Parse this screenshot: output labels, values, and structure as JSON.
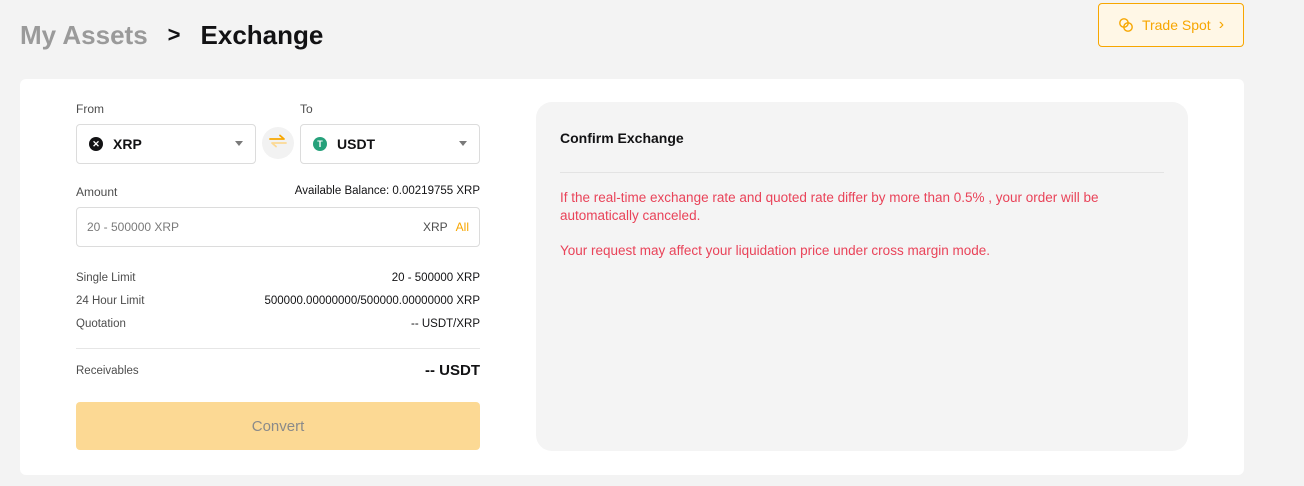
{
  "breadcrumb": {
    "parent": "My Assets",
    "separator": ">",
    "current": "Exchange"
  },
  "trade_spot": {
    "label": "Trade Spot",
    "icon": "coin-swap-icon",
    "chevron": "›"
  },
  "form": {
    "from_label": "From",
    "to_label": "To",
    "from_coin": {
      "name": "XRP",
      "icon": "xrp-icon",
      "icon_glyph": "✕",
      "color": "#121214"
    },
    "to_coin": {
      "name": "USDT",
      "icon": "usdt-icon",
      "icon_glyph": "T",
      "color": "#26a17b"
    },
    "amount_label": "Amount",
    "available_balance": "Available Balance: 0.00219755 XRP",
    "amount_placeholder": "20 - 500000 XRP",
    "amount_unit": "XRP",
    "amount_all": "All",
    "single_limit_label": "Single Limit",
    "single_limit_value": "20 - 500000 XRP",
    "day_limit_label": "24 Hour Limit",
    "day_limit_value": "500000.00000000/500000.00000000 XRP",
    "quotation_label": "Quotation",
    "quotation_value": "-- USDT/XRP",
    "receivables_label": "Receivables",
    "receivables_value": "-- USDT",
    "convert_label": "Convert"
  },
  "confirm": {
    "title": "Confirm Exchange",
    "warning_1": "If the real-time exchange rate and quoted rate differ by more than 0.5% , your order will be automatically canceled.",
    "warning_2": "Your request may affect your liquidation price under cross margin mode."
  },
  "colors": {
    "accent": "#f7a600",
    "warning": "#e94359",
    "convert_disabled": "#fcd994"
  }
}
